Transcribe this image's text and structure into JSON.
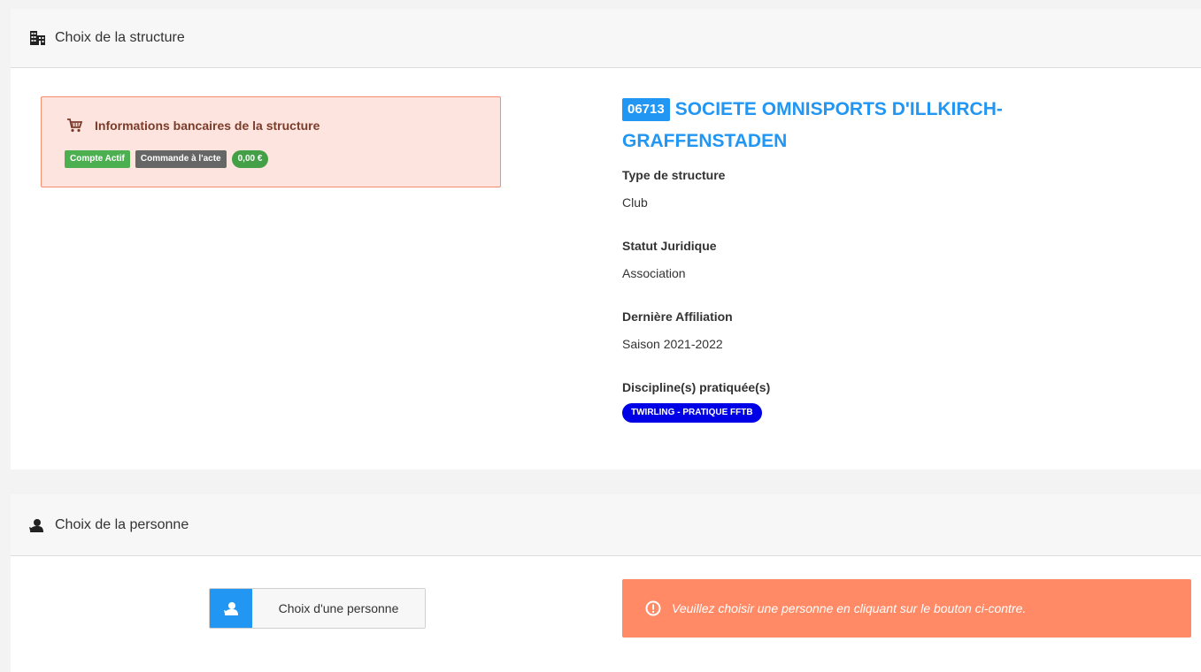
{
  "structure_panel": {
    "title": "Choix de la structure",
    "icon": "building-icon"
  },
  "bank_info": {
    "title": "Informations bancaires de la structure",
    "icon": "cart-icon",
    "badges": {
      "account_status": "Compte Actif",
      "order_mode": "Commande à l'acte",
      "balance": "0,00 €"
    },
    "colors": {
      "background": "#fde4de",
      "border": "#f28e6c",
      "title": "#7a3c2a"
    }
  },
  "structure": {
    "code": "06713",
    "name": "SOCIETE OMNISPORTS D'ILLKIRCH-GRAFFENSTADEN",
    "fields": {
      "type_label": "Type de structure",
      "type_value": "Club",
      "legal_label": "Statut Juridique",
      "legal_value": "Association",
      "affiliation_label": "Dernière Affiliation",
      "affiliation_value": "Saison 2021-2022",
      "discipline_label": "Discipline(s) pratiquée(s)",
      "discipline_value": "TWIRLING - PRATIQUE FFTB"
    },
    "colors": {
      "accent": "#2196f3",
      "discipline": "#0000e6"
    }
  },
  "person_panel": {
    "title": "Choix de la personne",
    "icon": "user-icon",
    "button_label": "Choix d'une personne",
    "alert_text": "Veuillez choisir une personne en cliquant sur le bouton ci-contre.",
    "alert_icon": "alert-circle-icon",
    "colors": {
      "alert": "#ff8a65",
      "button_icon_bg": "#2196f3"
    }
  }
}
